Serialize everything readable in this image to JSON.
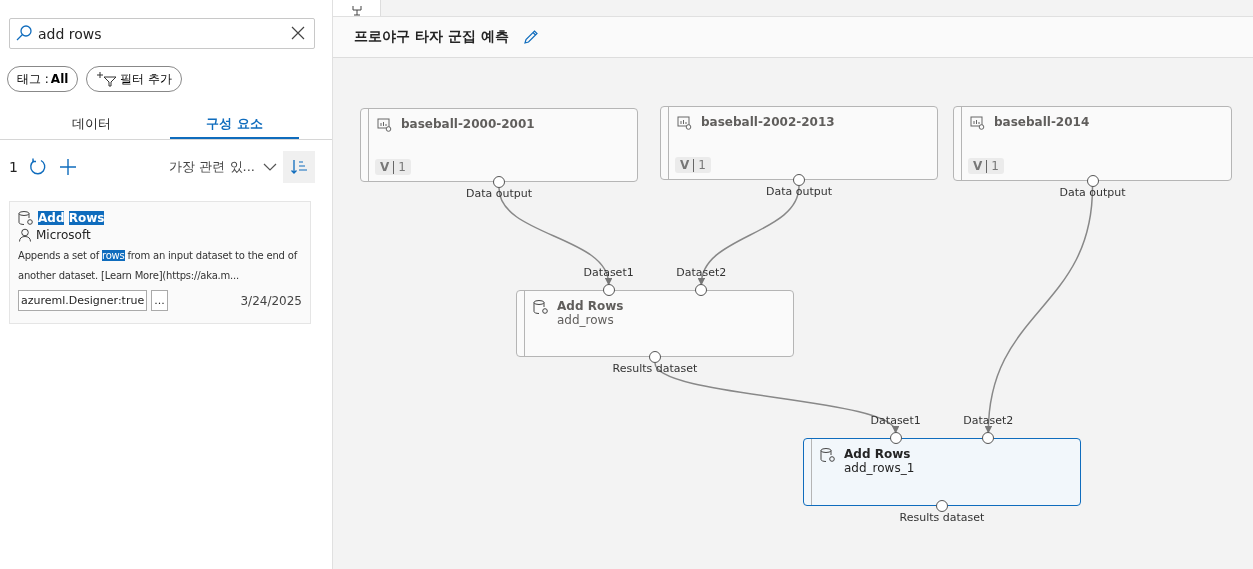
{
  "search": {
    "value": "add rows"
  },
  "chips": [
    {
      "label": "태그 : ",
      "value": "All"
    },
    {
      "label": "필터 추가"
    }
  ],
  "tabs": [
    {
      "label": "데이터",
      "selected": false
    },
    {
      "label": "구성 요소",
      "selected": true
    }
  ],
  "toolbar": {
    "count": "1",
    "sort": "가장 관련 있..."
  },
  "results": [
    {
      "title": [
        {
          "text": "Add",
          "highlight": true
        },
        {
          "text": "Rows",
          "highlight": true
        }
      ],
      "author": "Microsoft",
      "description": [
        {
          "text": "Appends a set of ",
          "highlight": false
        },
        {
          "text": "rows",
          "highlight": true
        },
        {
          "text": " from an input dataset to the end of another dataset. [Learn More](https://aka.m...",
          "highlight": false
        }
      ],
      "tags": [
        "azureml.Designer:true",
        "..."
      ],
      "date": "3/24/2025"
    }
  ],
  "pipeline": {
    "title": "프로야구 타자 군집 예측"
  },
  "nodes": [
    {
      "kind": "dataset",
      "title": "baseball-2000-2001",
      "version": [
        "V",
        "1"
      ],
      "selected": false,
      "outputs": [
        "Data output"
      ]
    },
    {
      "kind": "dataset",
      "title": "baseball-2002-2013",
      "version": [
        "V",
        "1"
      ],
      "selected": false,
      "outputs": [
        "Data output"
      ]
    },
    {
      "kind": "dataset",
      "title": "baseball-2014",
      "version": [
        "V",
        "1"
      ],
      "selected": false,
      "outputs": [
        "Data output"
      ]
    },
    {
      "kind": "module",
      "title": "Add Rows",
      "subtitle": "add_rows",
      "selected": false,
      "inputs": [
        "Dataset1",
        "Dataset2"
      ],
      "outputs": [
        "Results dataset"
      ]
    },
    {
      "kind": "module",
      "title": "Add Rows",
      "subtitle": "add_rows_1",
      "selected": true,
      "inputs": [
        "Dataset1",
        "Dataset2"
      ],
      "outputs": [
        "Results dataset"
      ]
    }
  ]
}
